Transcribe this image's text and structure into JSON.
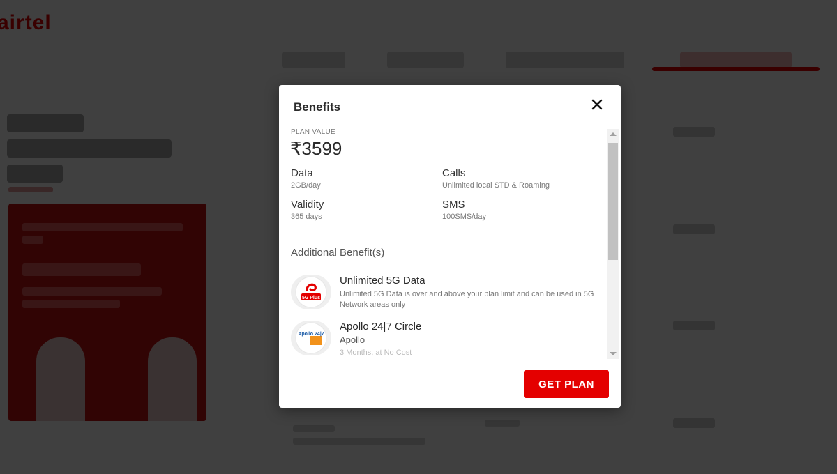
{
  "background": {
    "logo": "airtel"
  },
  "modal": {
    "title": "Benefits",
    "close_icon": "close-icon",
    "plan_value_label": "PLAN VALUE",
    "plan_value": "₹3599",
    "details": [
      {
        "label": "Data",
        "value": "2GB/day"
      },
      {
        "label": "Calls",
        "value": "Unlimited local STD & Roaming"
      },
      {
        "label": "Validity",
        "value": "365 days"
      },
      {
        "label": "SMS",
        "value": "100SMS/day"
      }
    ],
    "additional_heading": "Additional Benefit(s)",
    "benefits": [
      {
        "icon": "airtel-5g-plus-icon",
        "icon_text": "5G Plus",
        "title": "Unlimited 5G Data",
        "description": "Unlimited 5G Data is over and above your plan limit and can be used in 5G Network areas only"
      },
      {
        "icon": "apollo-24-7-icon",
        "icon_text": "Apollo 24|7",
        "title": "Apollo 24|7 Circle",
        "subtitle": "Apollo",
        "note": "3 Months, at No Cost"
      }
    ],
    "cta_label": "GET PLAN"
  },
  "colors": {
    "brand": "#e40000",
    "overlay": "rgba(0,0,0,0.75)"
  }
}
